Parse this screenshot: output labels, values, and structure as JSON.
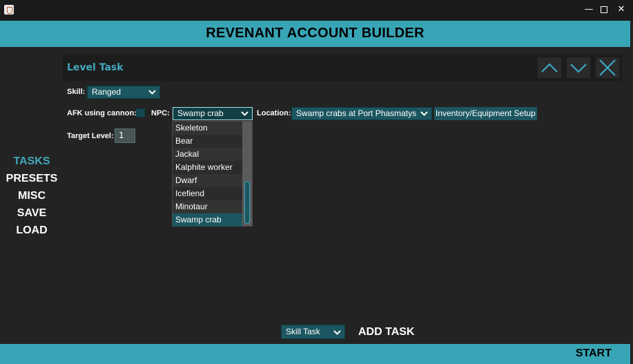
{
  "window": {
    "icon": "java-coffee-icon",
    "minimize": "—",
    "close": "✕"
  },
  "header": {
    "title": "REVENANT ACCOUNT BUILDER"
  },
  "nav": [
    {
      "label": "TASKS",
      "active": true
    },
    {
      "label": "PRESETS"
    },
    {
      "label": "MISC"
    },
    {
      "label": "SAVE"
    },
    {
      "label": "LOAD"
    }
  ],
  "task": {
    "title": "Level Task",
    "skill_label": "Skill:",
    "skill_value": "Ranged",
    "afk_label": "AFK using cannon:",
    "npc_label": "NPC:",
    "npc_value": "Swamp crab",
    "location_label": "Location:",
    "location_value": "Swamp crabs at Port Phasmatys",
    "inventory_label": "Inventory/Equipment Setup",
    "target_label": "Target Level:",
    "target_value": "1"
  },
  "npc_options": [
    "Skeleton",
    "Bear",
    "Jackal",
    "Kalphite worker",
    "Dwarf",
    "Icefiend",
    "Minotaur",
    "Swamp crab"
  ],
  "bottom": {
    "task_type": "Skill Task",
    "add_task": "ADD TASK"
  },
  "footer": {
    "start": "START"
  },
  "colors": {
    "accent": "#38a5b6",
    "panel": "#1c1c1c",
    "background": "#232323",
    "combo": "#1c5660"
  }
}
